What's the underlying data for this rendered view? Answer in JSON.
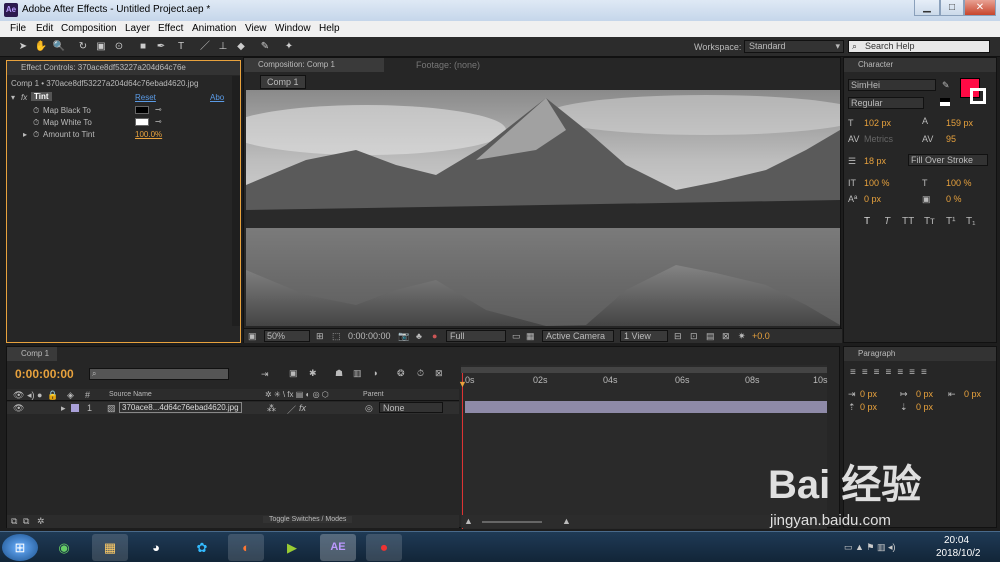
{
  "window": {
    "app_icon_label": "Ae",
    "title": "Adobe After Effects - Untitled Project.aep *",
    "min": "▁",
    "max": "□",
    "close": "✕"
  },
  "menu": [
    "File",
    "Edit",
    "Composition",
    "Layer",
    "Effect",
    "Animation",
    "View",
    "Window",
    "Help"
  ],
  "toolbar": {
    "workspace_label": "Workspace:",
    "workspace_value": "Standard",
    "search_placeholder": "Search Help"
  },
  "effect_controls": {
    "tab": "Effect Controls: 370ace8df53227a204d64c76e",
    "source": "Comp 1 • 370ace8df53227a204d64c76ebad4620.jpg",
    "effect": {
      "name": "Tint",
      "reset": "Reset",
      "about": "Abo"
    },
    "props": [
      {
        "label": "Map Black To",
        "color": "#000000"
      },
      {
        "label": "Map White To",
        "color": "#ffffff"
      },
      {
        "label": "Amount to Tint",
        "value": "100.0%"
      }
    ]
  },
  "composition": {
    "tab": "Composition: Comp 1",
    "footage_tab": "Footage: (none)",
    "comp_tab": "Comp 1",
    "zoom": "50%",
    "timecode": "0:00:00:00",
    "resolution": "Full",
    "camera": "Active Camera",
    "views": "1 View",
    "exposure": "+0.0"
  },
  "character": {
    "tab": "Character",
    "font": "SimHei",
    "style": "Regular",
    "fill_color": "#ff0a45",
    "font_size": "102 px",
    "leading": "159 px",
    "kerning": "Metrics",
    "tracking": "95",
    "stroke_width": "18 px",
    "stroke_type": "Fill Over Stroke",
    "vscale": "100 %",
    "hscale": "100 %",
    "baseline": "0 px",
    "tsume": "0 %",
    "styles": [
      "T",
      "T",
      "TT",
      "Tт",
      "T¹",
      "T₁"
    ]
  },
  "timeline": {
    "tab": "Comp 1",
    "timecode": "0:00:00:00",
    "headers": {
      "num": "#",
      "source": "Source Name",
      "parent": "Parent"
    },
    "ruler": [
      "0s",
      "02s",
      "04s",
      "06s",
      "08s",
      "10s"
    ],
    "layers": [
      {
        "num": "1",
        "name": "370ace8...4d64c76ebad4620.jpg",
        "parent": "None"
      }
    ],
    "toggle_label": "Toggle Switches / Modes"
  },
  "paragraph": {
    "tab": "Paragraph",
    "indent_left": "0 px",
    "indent_first": "0 px",
    "indent_right": "0 px",
    "space_before": "0 px",
    "space_after": "0 px"
  },
  "taskbar": {
    "time": "20:04",
    "date": "2018/10/2"
  },
  "watermark": {
    "text": "Bai 经验",
    "url": "jingyan.baidu.com"
  }
}
